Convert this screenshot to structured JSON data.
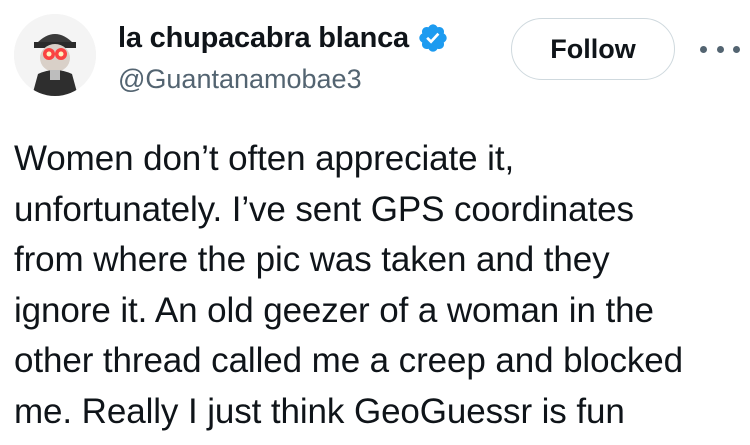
{
  "author": {
    "display_name": "la chupacabra blanca",
    "handle": "@Guantanamobae3",
    "verified": true,
    "avatar_icon": "profile-picture-avatar"
  },
  "actions": {
    "follow_label": "Follow",
    "more_icon": "ellipsis-icon"
  },
  "tweet": {
    "text": "Women don’t often appreciate it,\nunfortunately. I’ve sent GPS coordinates\nfrom where the pic was taken and they\nignore it. An old geezer of a woman in the\nother thread called me a creep and blocked\nme. Really I just think GeoGuessr is fun"
  },
  "colors": {
    "text_primary": "#0f1419",
    "text_secondary": "#536471",
    "verified_blue": "#1d9bf0",
    "button_border": "#cfd9de"
  }
}
